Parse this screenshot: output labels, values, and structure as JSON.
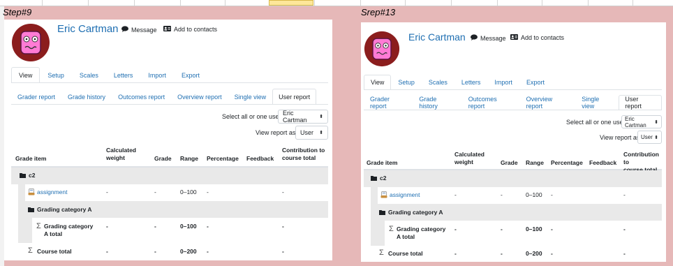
{
  "steps": {
    "left": "Step#9",
    "right": "Srep#13"
  },
  "profile": {
    "name": "Eric Cartman",
    "message_label": "Message",
    "contacts_label": "Add to contacts",
    "message_icon": "speech-bubble-icon",
    "contacts_icon": "address-card-icon"
  },
  "tabs_main": [
    "View",
    "Setup",
    "Scales",
    "Letters",
    "Import",
    "Export"
  ],
  "tabs_sub": [
    "Grader report",
    "Grade history",
    "Outcomes report",
    "Overview report",
    "Single view",
    "User report"
  ],
  "controls": {
    "select_user_label": "Select all or one user",
    "select_user_value": "Eric Cartman",
    "view_as_label": "View report as",
    "view_as_value": "User"
  },
  "table": {
    "headers": {
      "grade_item": "Grade item",
      "calc_weight_1": "Calculated",
      "calc_weight_2": "weight",
      "grade": "Grade",
      "range": "Range",
      "percentage": "Percentage",
      "feedback": "Feedback",
      "contribution_1": "Contribution to",
      "contribution_2": "course total"
    },
    "rows": [
      {
        "item": "c2",
        "icon": "folder-icon"
      },
      {
        "item": "assignment",
        "icon": "assignment-icon",
        "weight": "-",
        "grade": "-",
        "range": "0–100",
        "percentage": "-",
        "contribution": "-"
      },
      {
        "item": "Grading category A",
        "icon": "folder-icon"
      },
      {
        "item_1": "Grading category",
        "item_2": "A total",
        "icon": "sigma-icon",
        "weight": "-",
        "grade": "-",
        "range": "0–100",
        "percentage": "-",
        "contribution": "-"
      },
      {
        "item": "Course total",
        "icon": "sigma-icon",
        "weight": "-",
        "grade": "-",
        "range": "0–200",
        "percentage": "-",
        "contribution": "-"
      }
    ]
  },
  "colors": {
    "background": "#e6b8b8",
    "link": "#1f6fb2",
    "category_row": "#e9e9e9"
  }
}
